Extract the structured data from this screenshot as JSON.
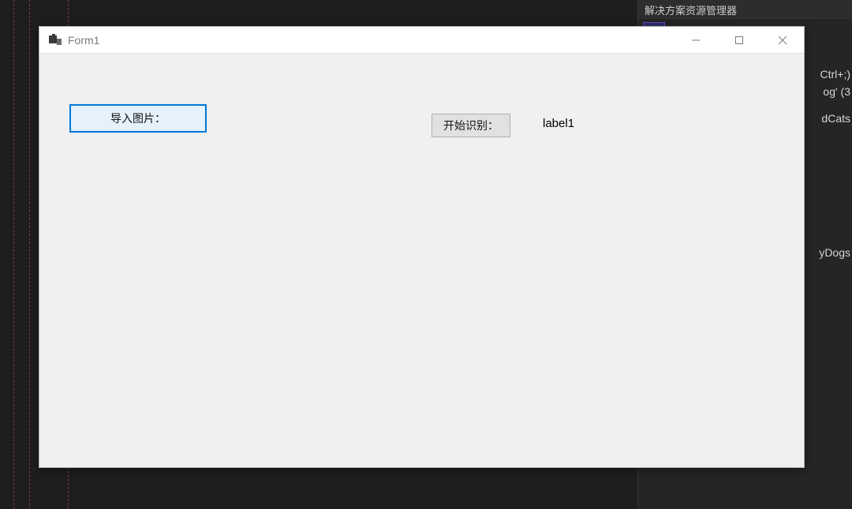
{
  "side_panel": {
    "title": "解决方案资源管理器",
    "fragments": {
      "shortcut": "Ctrl+;)",
      "f1": "og' (3",
      "f2": "dCats",
      "f3": "yDogs"
    }
  },
  "form": {
    "title": "Form1",
    "buttons": {
      "import": "导入图片：",
      "recognize": "开始识别："
    },
    "label1": "label1"
  }
}
